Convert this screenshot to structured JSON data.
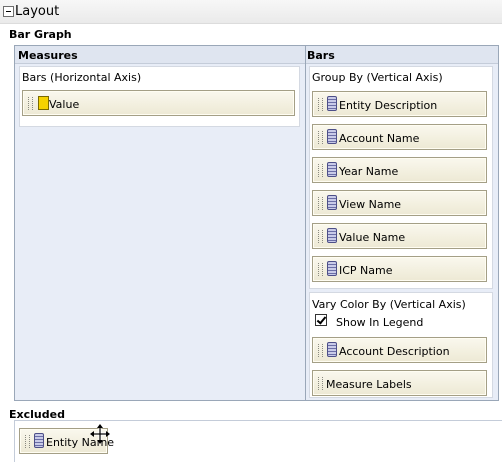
{
  "header": {
    "title": "Layout"
  },
  "section_title": "Bar Graph",
  "measures": {
    "title": "Measures",
    "x_axis_label": "Bars (Horizontal Axis)",
    "items": [
      {
        "label": "Value",
        "icon": "measure-icon"
      }
    ]
  },
  "bars": {
    "title": "Bars",
    "group_by_label": "Group By (Vertical Axis)",
    "group_by_items": [
      {
        "label": "Entity Description",
        "icon": "dimension-icon"
      },
      {
        "label": "Account Name",
        "icon": "dimension-icon"
      },
      {
        "label": "Year Name",
        "icon": "dimension-icon"
      },
      {
        "label": "View Name",
        "icon": "dimension-icon"
      },
      {
        "label": "Value Name",
        "icon": "dimension-icon"
      },
      {
        "label": "ICP Name",
        "icon": "dimension-icon"
      }
    ],
    "vary_color_label": "Vary Color By (Vertical Axis)",
    "show_in_legend": {
      "label": "Show In Legend",
      "checked": true
    },
    "vary_color_items": [
      {
        "label": "Account Description",
        "icon": "dimension-icon"
      },
      {
        "label": "Measure Labels"
      }
    ]
  },
  "excluded": {
    "title": "Excluded",
    "items": [
      {
        "label": "Entity Name",
        "icon": "dimension-icon"
      }
    ]
  }
}
